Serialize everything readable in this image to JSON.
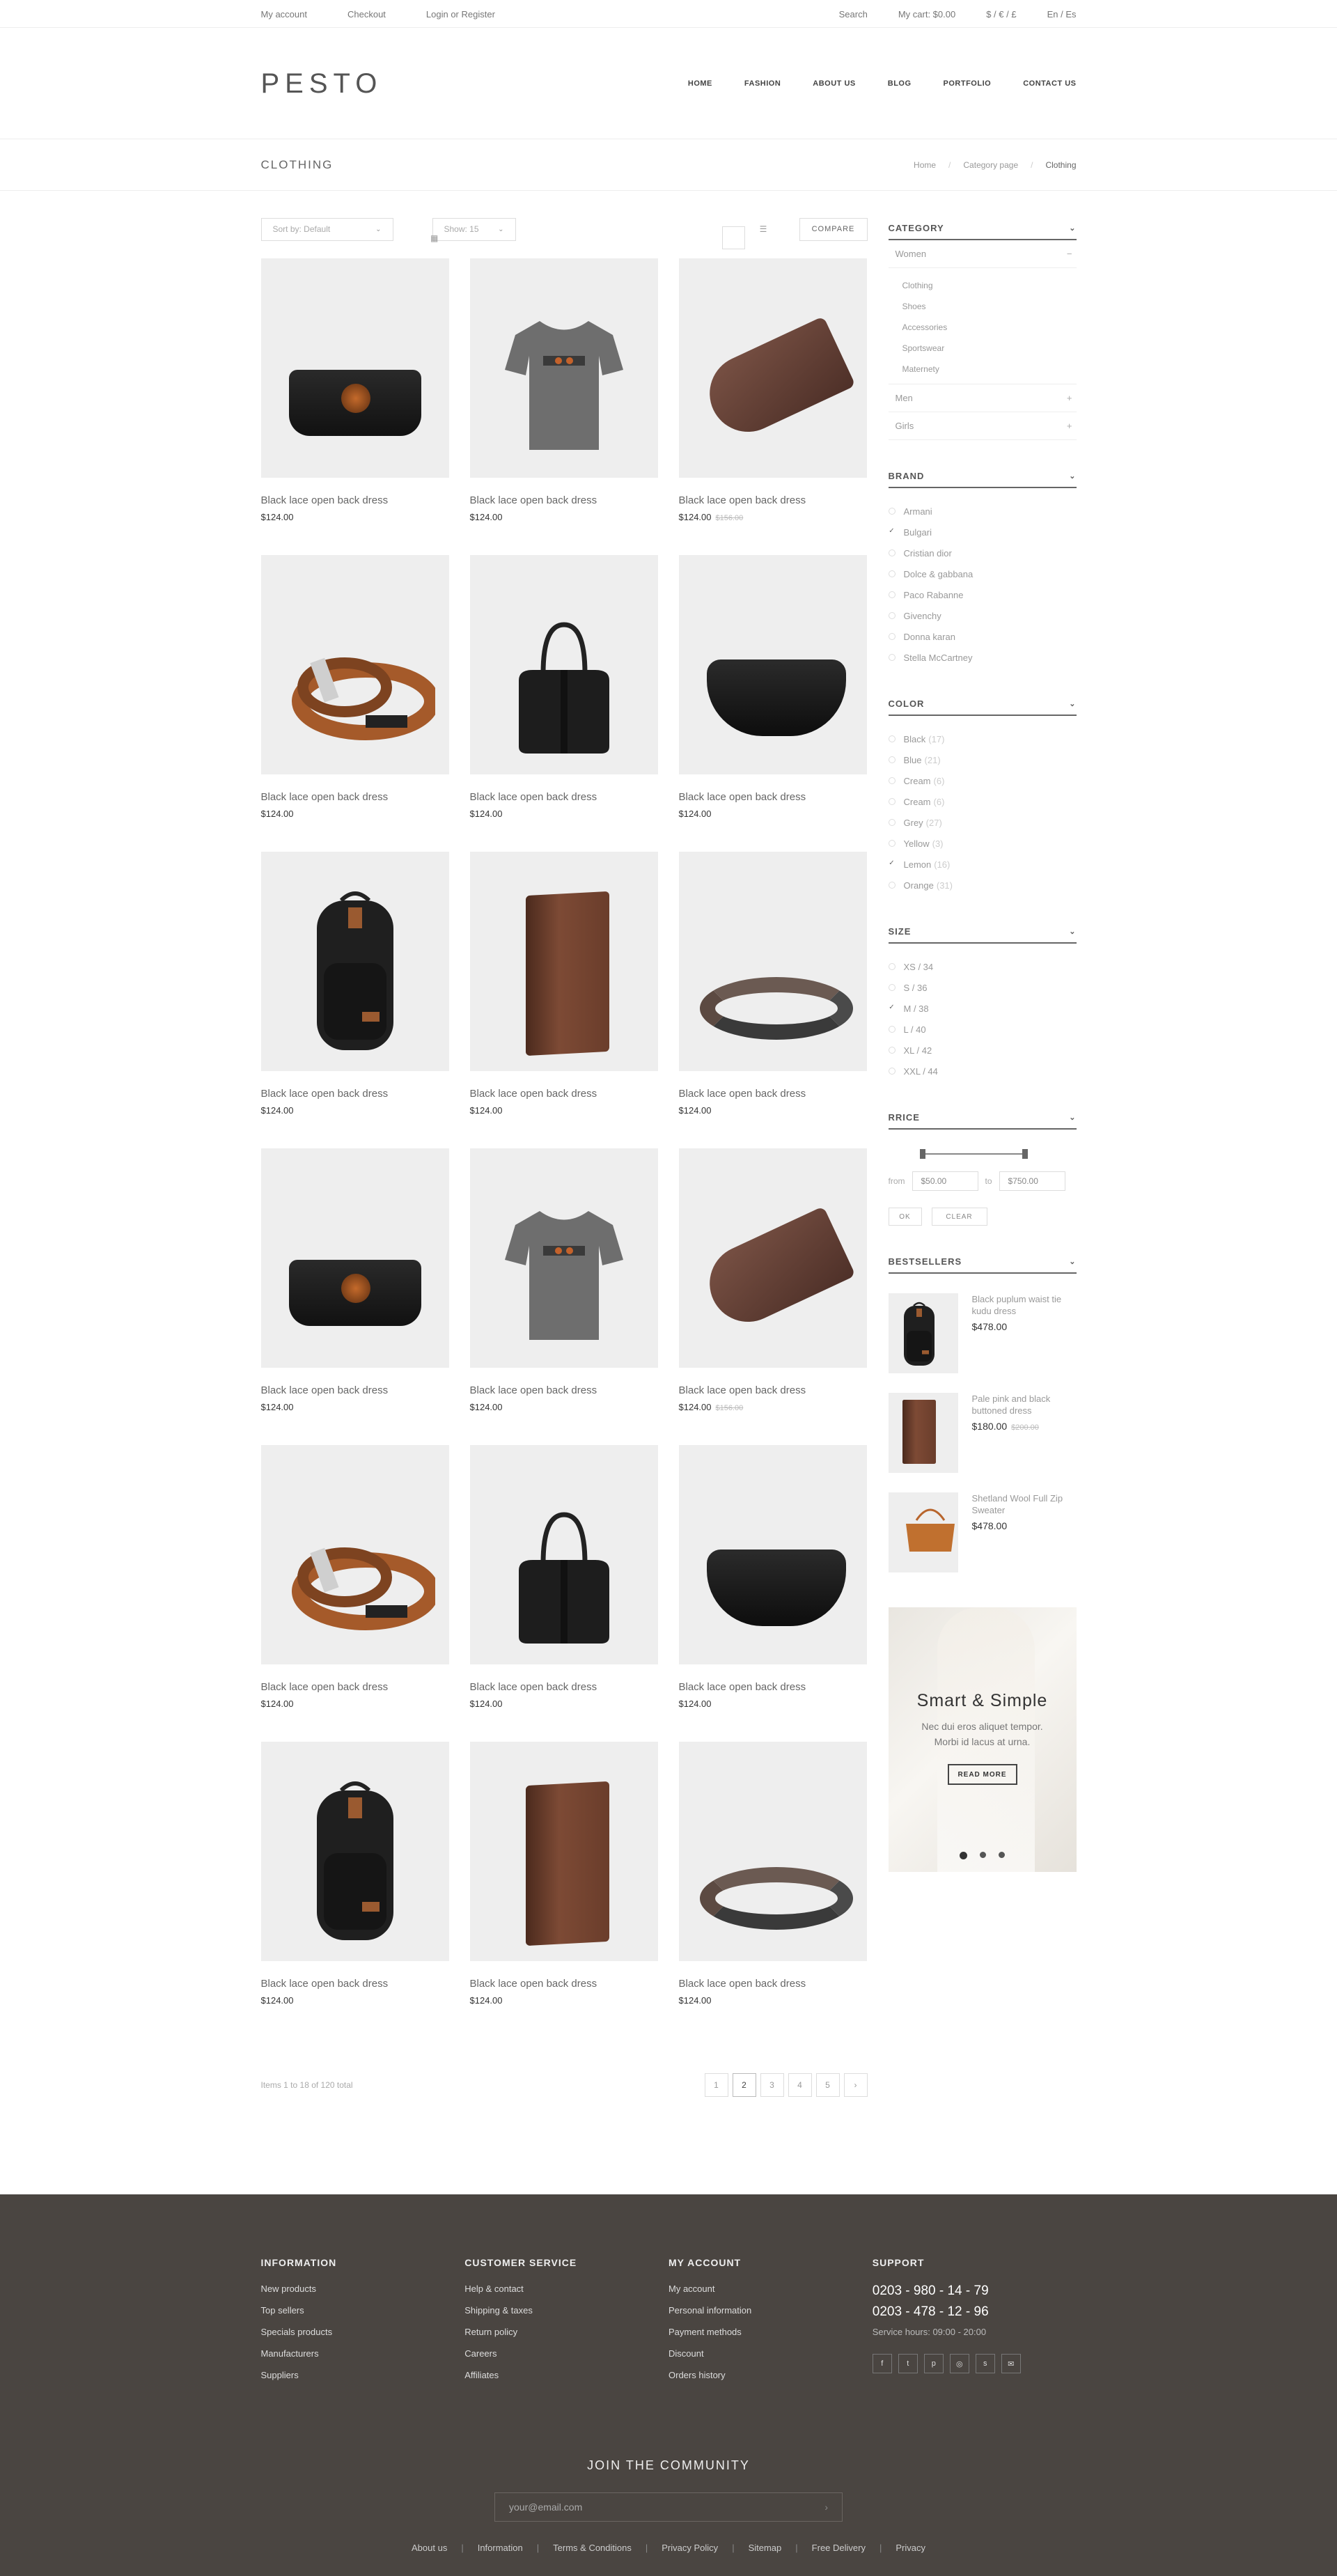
{
  "topbar": {
    "my_account": "My account",
    "checkout": "Checkout",
    "login": "Login or Register",
    "search": "Search",
    "cart": "My cart: $0.00",
    "currency": "$ / € / £",
    "language": "En / Es"
  },
  "header": {
    "logo": "PESTO",
    "nav": [
      "HOME",
      "FASHION",
      "ABOUT US",
      "BLOG",
      "PORTFOLIO",
      "CONTACT US"
    ]
  },
  "titlebar": {
    "title": "CLOTHING",
    "crumbs": [
      "Home",
      "Category page",
      "Clothing"
    ]
  },
  "toolbar": {
    "sort": "Sort by: Default",
    "show": "Show: 15",
    "compare": "COMPARE"
  },
  "products": [
    {
      "name": "Black lace open back dress",
      "price": "$124.00",
      "old": "",
      "shape": "clutch"
    },
    {
      "name": "Black lace open back dress",
      "price": "$124.00",
      "old": "",
      "shape": "tshirt"
    },
    {
      "name": "Black lace open back dress",
      "price": "$124.00",
      "old": "$156.00",
      "shape": "tag"
    },
    {
      "name": "Black lace open back dress",
      "price": "$124.00",
      "old": "",
      "shape": "belt"
    },
    {
      "name": "Black lace open back dress",
      "price": "$124.00",
      "old": "",
      "shape": "bag"
    },
    {
      "name": "Black lace open back dress",
      "price": "$124.00",
      "old": "",
      "shape": "fanny"
    },
    {
      "name": "Black lace open back dress",
      "price": "$124.00",
      "old": "",
      "shape": "backpack"
    },
    {
      "name": "Black lace open back dress",
      "price": "$124.00",
      "old": "",
      "shape": "wallet"
    },
    {
      "name": "Black lace open back dress",
      "price": "$124.00",
      "old": "",
      "shape": "bracelet"
    },
    {
      "name": "Black lace open back dress",
      "price": "$124.00",
      "old": "",
      "shape": "clutch"
    },
    {
      "name": "Black lace open back dress",
      "price": "$124.00",
      "old": "",
      "shape": "tshirt"
    },
    {
      "name": "Black lace open back dress",
      "price": "$124.00",
      "old": "$156.00",
      "shape": "tag"
    },
    {
      "name": "Black lace open back dress",
      "price": "$124.00",
      "old": "",
      "shape": "belt"
    },
    {
      "name": "Black lace open back dress",
      "price": "$124.00",
      "old": "",
      "shape": "bag"
    },
    {
      "name": "Black lace open back dress",
      "price": "$124.00",
      "old": "",
      "shape": "fanny"
    },
    {
      "name": "Black lace open back dress",
      "price": "$124.00",
      "old": "",
      "shape": "backpack"
    },
    {
      "name": "Black lace open back dress",
      "price": "$124.00",
      "old": "",
      "shape": "wallet"
    },
    {
      "name": "Black lace open back dress",
      "price": "$124.00",
      "old": "",
      "shape": "bracelet"
    }
  ],
  "pager": {
    "items": "Items 1 to 18 of 120 total",
    "pages": [
      "1",
      "2",
      "3",
      "4",
      "5",
      "›"
    ],
    "active": "2"
  },
  "sidebar": {
    "category": {
      "title": "CATEGORY",
      "groups": [
        {
          "label": "Women",
          "toggle": "−",
          "children": [
            "Clothing",
            "Shoes",
            "Accessories",
            "Sportswear",
            "Maternety"
          ]
        },
        {
          "label": "Men",
          "toggle": "+",
          "children": []
        },
        {
          "label": "Girls",
          "toggle": "+",
          "children": []
        }
      ]
    },
    "brand": {
      "title": "BRAND",
      "items": [
        {
          "label": "Armani",
          "n": "",
          "checked": false
        },
        {
          "label": "Bulgari",
          "n": "",
          "checked": true
        },
        {
          "label": "Cristian dior",
          "n": "",
          "checked": false
        },
        {
          "label": "Dolce & gabbana",
          "n": "",
          "checked": false
        },
        {
          "label": "Paco Rabanne",
          "n": "",
          "checked": false
        },
        {
          "label": "Givenchy",
          "n": "",
          "checked": false
        },
        {
          "label": "Donna karan",
          "n": "",
          "checked": false
        },
        {
          "label": "Stella McCartney",
          "n": "",
          "checked": false
        }
      ]
    },
    "color": {
      "title": "COLOR",
      "items": [
        {
          "label": "Black",
          "n": "(17)",
          "checked": false
        },
        {
          "label": "Blue",
          "n": "(21)",
          "checked": false
        },
        {
          "label": "Cream",
          "n": "(6)",
          "checked": false
        },
        {
          "label": "Cream",
          "n": "(6)",
          "checked": false
        },
        {
          "label": "Grey",
          "n": "(27)",
          "checked": false
        },
        {
          "label": "Yellow",
          "n": "(3)",
          "checked": false
        },
        {
          "label": "Lemon",
          "n": "(16)",
          "checked": true
        },
        {
          "label": "Orange",
          "n": "(31)",
          "checked": false
        }
      ]
    },
    "size": {
      "title": "SIZE",
      "items": [
        {
          "label": "XS / 34",
          "n": "",
          "checked": false
        },
        {
          "label": "S / 36",
          "n": "",
          "checked": false
        },
        {
          "label": "M / 38",
          "n": "",
          "checked": true
        },
        {
          "label": "L / 40",
          "n": "",
          "checked": false
        },
        {
          "label": "XL / 42",
          "n": "",
          "checked": false
        },
        {
          "label": "XXL / 44",
          "n": "",
          "checked": false
        }
      ]
    },
    "price": {
      "title": "RRICE",
      "from_label": "from",
      "from": "$50.00",
      "to_label": "to",
      "to": "$750.00",
      "ok": "OK",
      "clear": "CLEAR"
    },
    "bestsellers": {
      "title": "BESTSELLERS",
      "items": [
        {
          "name": "Black puplum waist tie kudu dress",
          "price": "$478.00",
          "old": "",
          "shape": "backpack"
        },
        {
          "name": "Pale pink and black buttoned dress",
          "price": "$180.00",
          "old": "$200.00",
          "shape": "wallet"
        },
        {
          "name": "Shetland Wool Full Zip Sweater",
          "price": "$478.00",
          "old": "",
          "shape": "handbag"
        }
      ]
    },
    "promo": {
      "title": "Smart & Simple",
      "line1": "Nec dui eros aliquet tempor.",
      "line2": "Morbi id lacus at urna.",
      "button": "READ MORE"
    }
  },
  "footer": {
    "information": {
      "title": "INFORMATION",
      "links": [
        "New products",
        "Top sellers",
        "Specials products",
        "Manufacturers",
        "Suppliers"
      ]
    },
    "service": {
      "title": "CUSTOMER SERVICE",
      "links": [
        "Help & contact",
        "Shipping & taxes",
        "Return policy",
        "Careers",
        "Affiliates"
      ]
    },
    "account": {
      "title": "MY ACCOUNT",
      "links": [
        "My account",
        "Personal information",
        "Payment methods",
        "Discount",
        "Orders history"
      ]
    },
    "support": {
      "title": "SUPPORT",
      "phone1": "0203 - 980 - 14 - 79",
      "phone2": "0203 - 478 - 12 - 96",
      "hours": "Service hours: 09:00 - 20:00"
    },
    "socials": [
      "facebook-icon",
      "twitter-icon",
      "pinterest-icon",
      "instagram-icon",
      "skype-icon",
      "mail-icon"
    ],
    "community": "JOIN THE COMMUNITY",
    "email_placeholder": "your@email.com",
    "bottom_links": [
      "About us",
      "Information",
      "Terms & Conditions",
      "Privacy Policy",
      "Sitemap",
      "Free Delivery",
      "Privacy"
    ]
  }
}
